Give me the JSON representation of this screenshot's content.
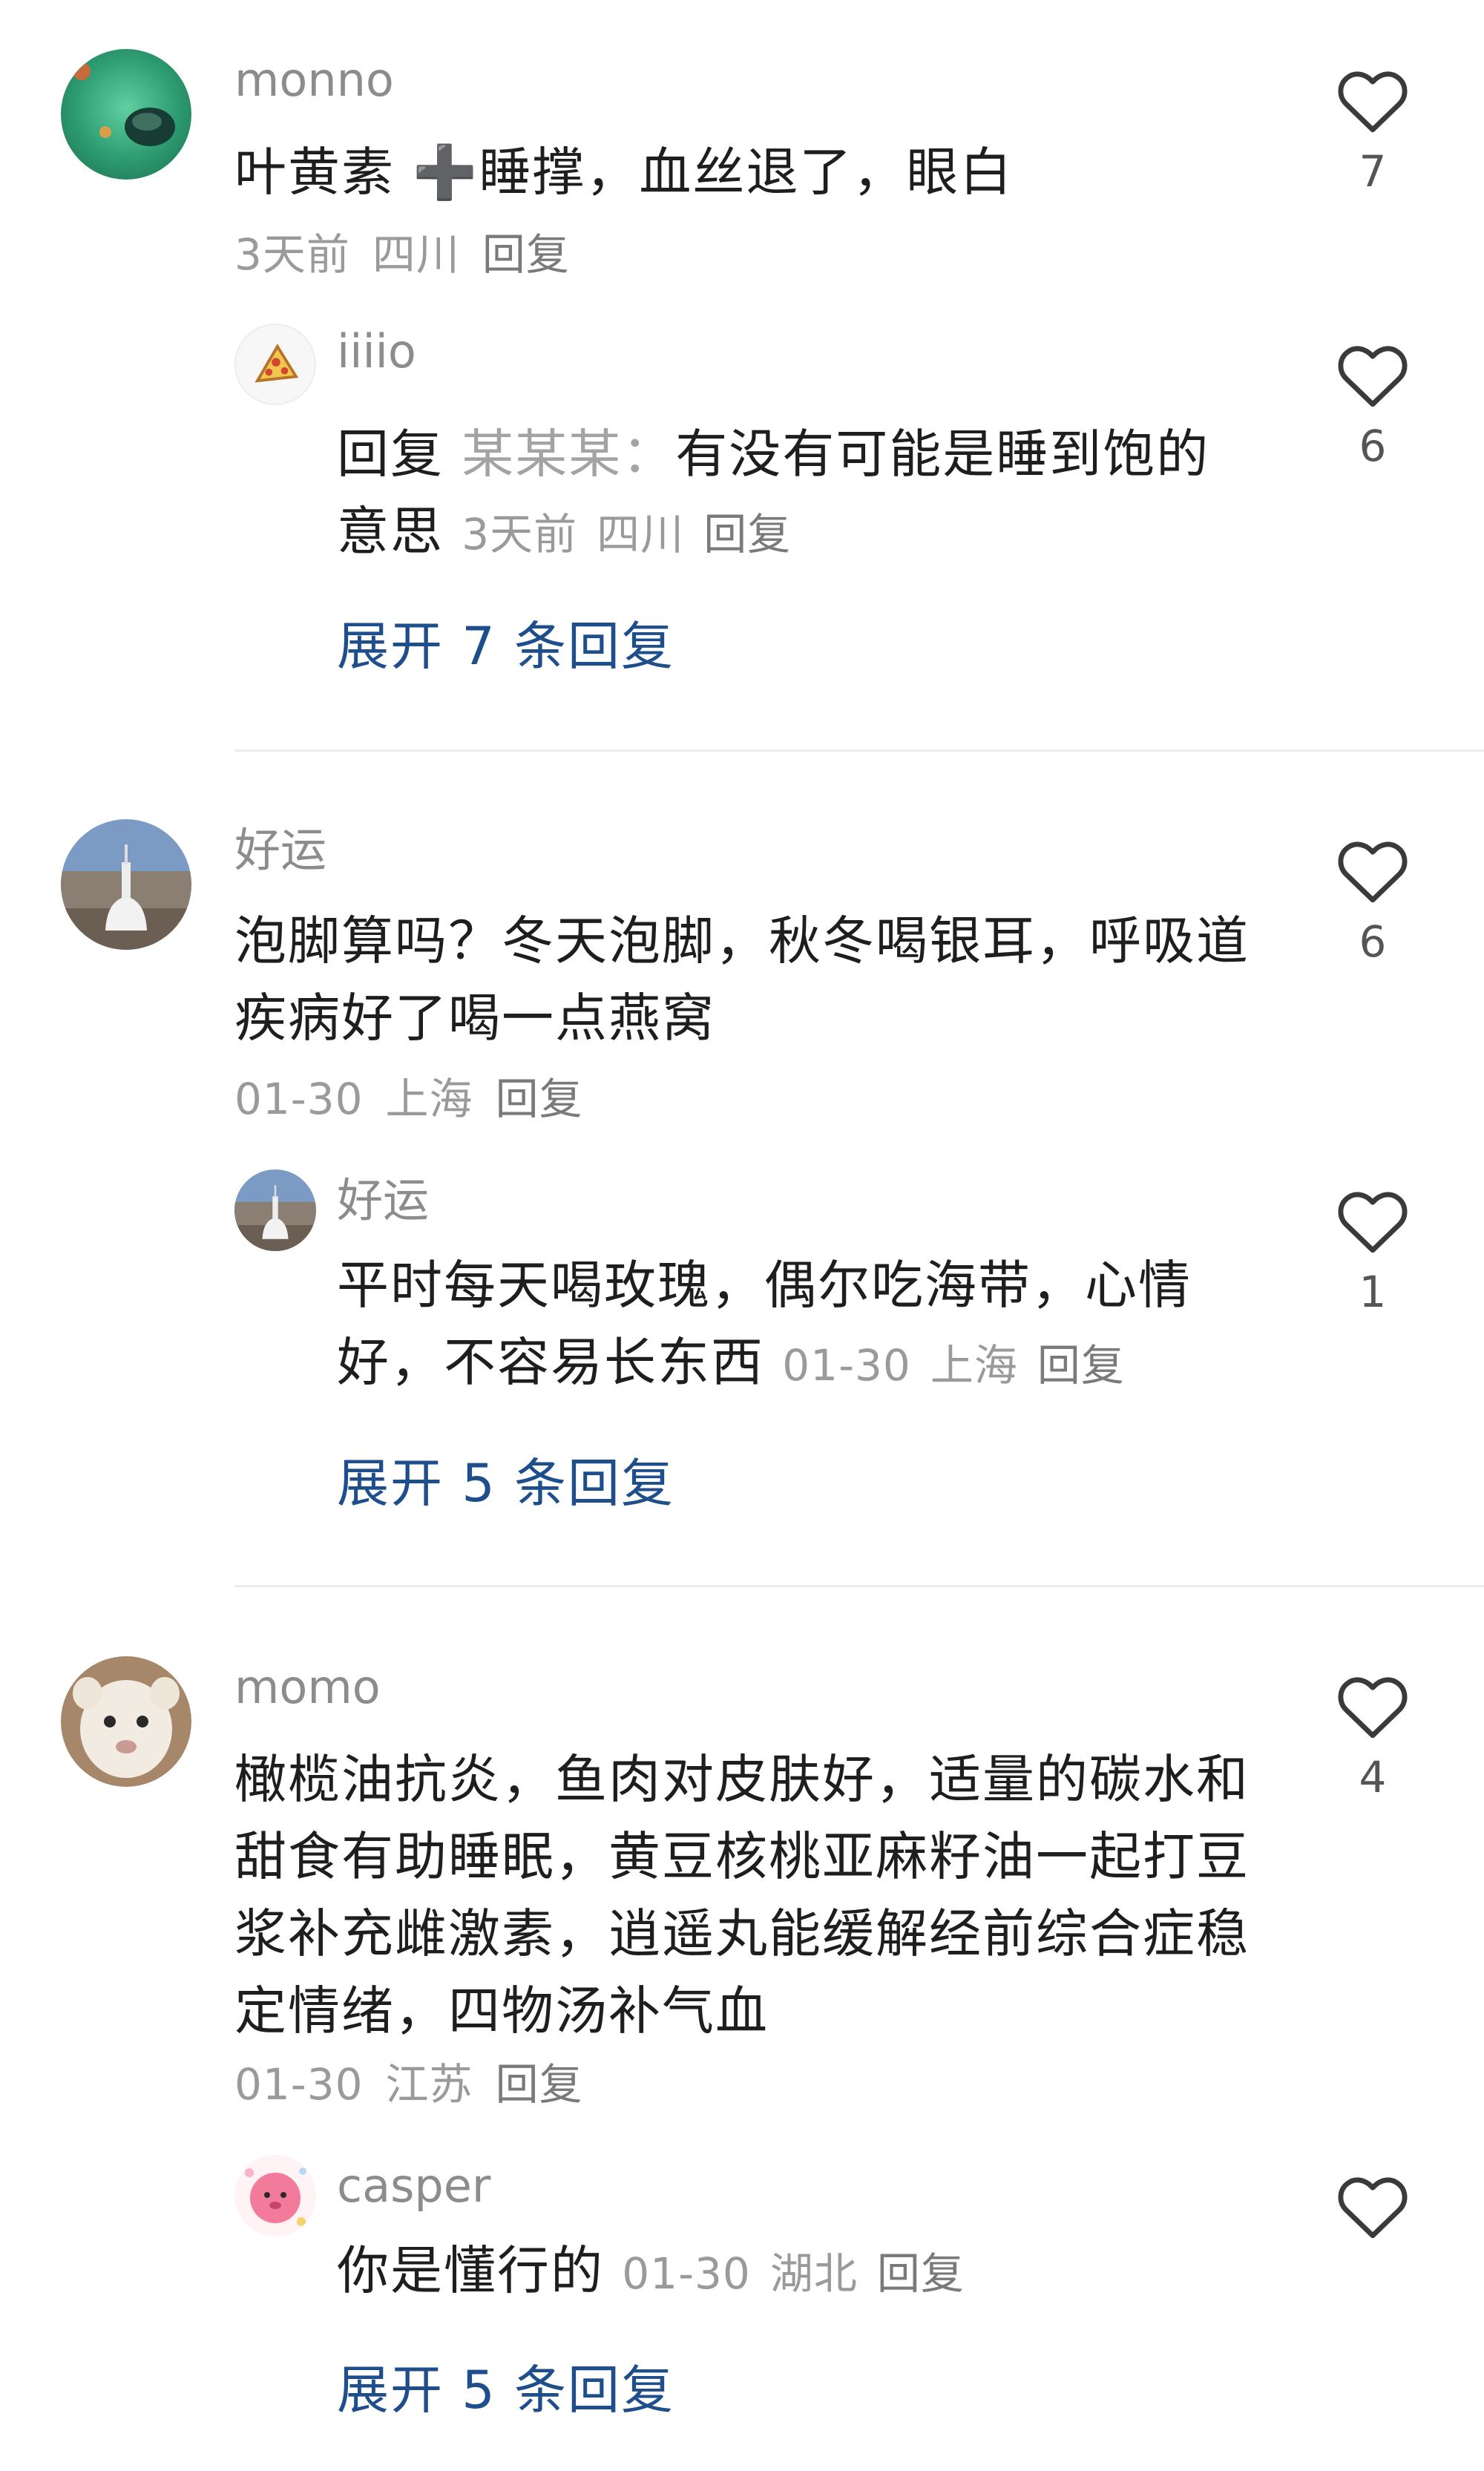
{
  "threads": [
    {
      "comment": {
        "username": "monno",
        "text": "叶黄素 ➕睡撑，血丝退了，眼白",
        "time": "3天前",
        "location": "四川",
        "reply_label": "回复",
        "likes": "7",
        "avatar": "ocean-avatar"
      },
      "reply": {
        "username": "iiiio",
        "reply_prefix": "回复",
        "reply_to": "某某某：",
        "text": "有没有可能是睡到饱的意思",
        "time": "3天前",
        "location": "四川",
        "reply_label": "回复",
        "likes": "6",
        "avatar": "pizza-avatar"
      },
      "expand_label": "展开 7 条回复"
    },
    {
      "comment": {
        "username": "好运",
        "text": "泡脚算吗？冬天泡脚，秋冬喝银耳，呼吸道疾病好了喝一点燕窝",
        "time": "01-30",
        "location": "上海",
        "reply_label": "回复",
        "likes": "6",
        "avatar": "stupa-avatar"
      },
      "reply": {
        "username": "好运",
        "text": "平时每天喝玫瑰，偶尔吃海带，心情好，不容易长东西",
        "time": "01-30",
        "location": "上海",
        "reply_label": "回复",
        "likes": "1",
        "avatar": "stupa-avatar"
      },
      "expand_label": "展开 5 条回复"
    },
    {
      "comment": {
        "username": "momo",
        "text": "橄榄油抗炎，鱼肉对皮肤好，适量的碳水和甜食有助睡眠，黄豆核桃亚麻籽油一起打豆浆补充雌激素，逍遥丸能缓解经前综合症稳定情绪，四物汤补气血",
        "time": "01-30",
        "location": "江苏",
        "reply_label": "回复",
        "likes": "4",
        "avatar": "white-lion-cub-avatar"
      },
      "reply": {
        "username": "casper",
        "text": "你是懂行的",
        "time": "01-30",
        "location": "湖北",
        "reply_label": "回复",
        "likes": "",
        "avatar": "pink-cartoon-avatar"
      },
      "expand_label": "展开 5 条回复"
    }
  ],
  "colors": {
    "username": "#8c8c8c",
    "body": "#1e1e1e",
    "meta": "#9a9a9a",
    "expand_link": "#1f4e8c",
    "divider": "#ececec"
  },
  "icons": {
    "like": "heart-outline-icon"
  }
}
